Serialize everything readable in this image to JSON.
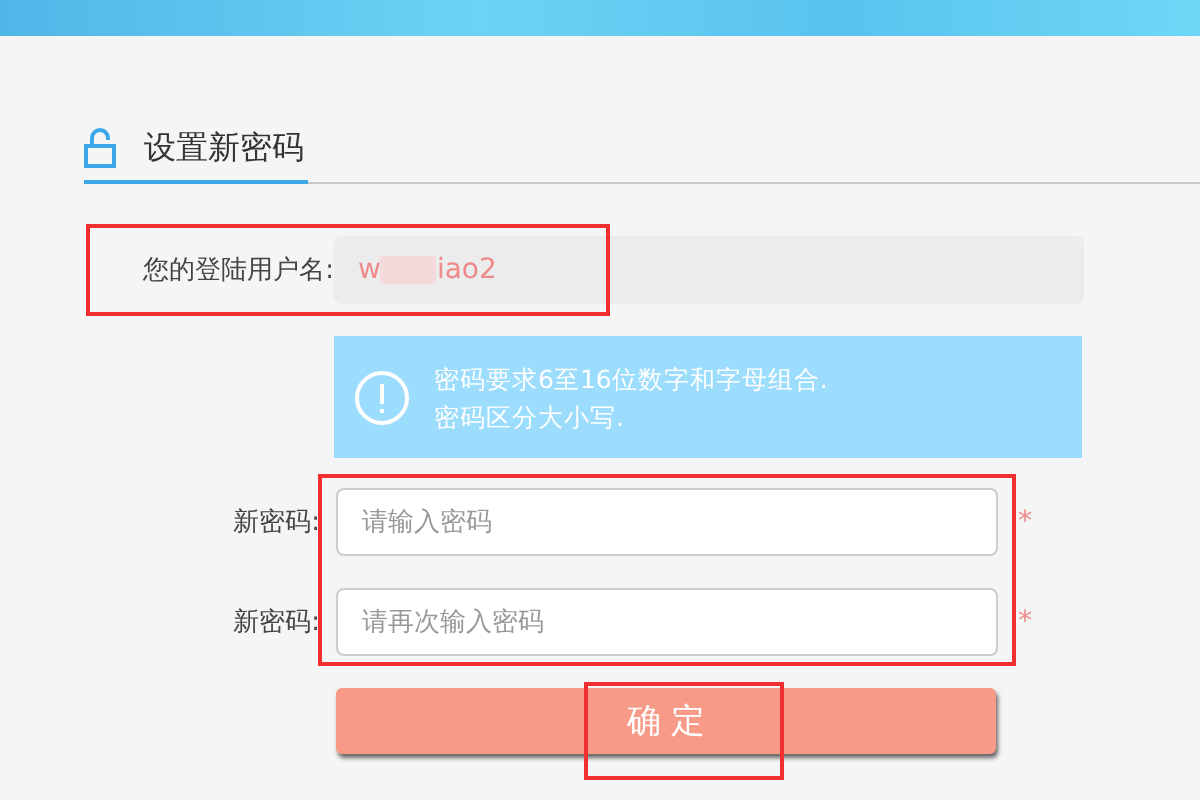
{
  "section_title": "设置新密码",
  "username": {
    "label": "您的登陆用户名:",
    "value_start": "w",
    "value_end": "iao2",
    "redacted": true,
    "highlighted": true
  },
  "notice": {
    "lines": [
      "密码要求6至16位数字和字母组合.",
      "密码区分大小写."
    ]
  },
  "password_fields": {
    "highlighted": true,
    "items": [
      {
        "label": "新密码:",
        "placeholder": "请输入密码",
        "required_mark": "*"
      },
      {
        "label": "新密码:",
        "placeholder": "请再次输入密码",
        "required_mark": "*"
      }
    ]
  },
  "confirm_button": {
    "label": "确 定",
    "highlighted": true
  }
}
